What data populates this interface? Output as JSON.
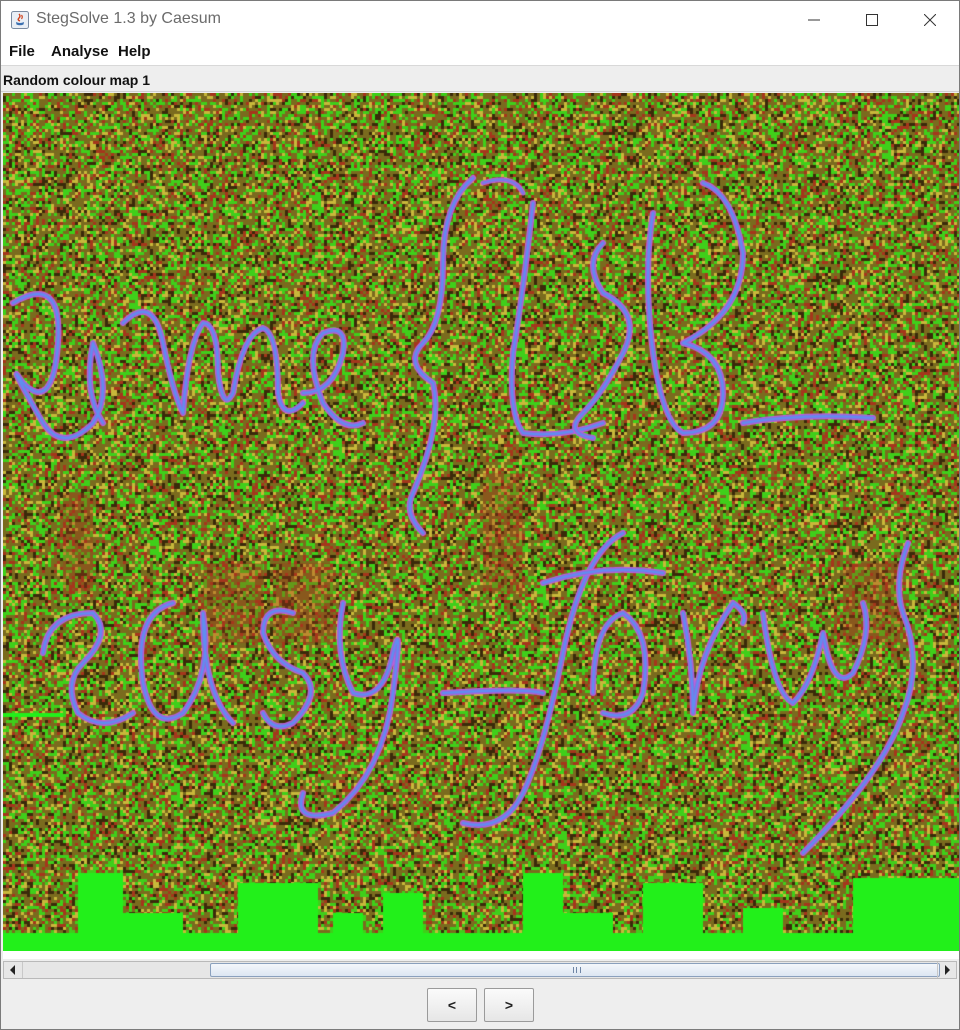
{
  "window": {
    "title": "StegSolve 1.3 by Caesum"
  },
  "menu": {
    "file": "File",
    "analyse": "Analyse",
    "help": "Help"
  },
  "viewer": {
    "plane_label": "Random colour map 1"
  },
  "navigation": {
    "prev_label": "<",
    "next_label": ">"
  },
  "icons": {
    "app": "java-app-icon",
    "minimize": "minimize-icon",
    "maximize": "maximize-icon",
    "close": "close-icon",
    "scroll_left": "chevron-left-icon",
    "scroll_right": "chevron-right-icon"
  },
  "colors": {
    "noise_base": "#7a6b1e",
    "noise_green": "#3fcf1a",
    "noise_red": "#a5361c",
    "noise_dark": "#3a2a0a",
    "noise_yellow": "#c8b83a",
    "bright_green": "#22f01a",
    "ink_purple": "#8a6ee0",
    "ink_blue": "#5f8ff0",
    "ink_magenta": "#c060d8",
    "scroll_thumb_border": "#8aa0bd"
  }
}
